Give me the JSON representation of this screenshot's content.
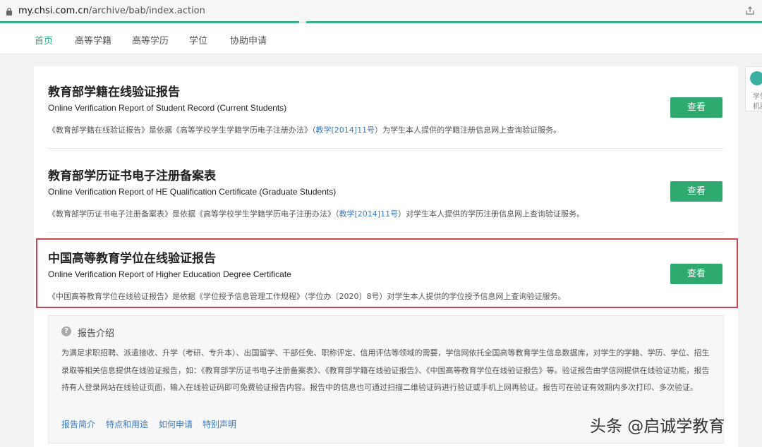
{
  "browser": {
    "url_host": "my.chsi.com.cn",
    "url_path": "/archive/bab/index.action"
  },
  "nav": {
    "items": [
      "首页",
      "高等学籍",
      "高等学历",
      "学位",
      "协助申请"
    ]
  },
  "float_widget": {
    "line1": "学信",
    "line2": "机器"
  },
  "reports": [
    {
      "title": "教育部学籍在线验证报告",
      "title_en": "Online Verification Report of Student Record (Current Students)",
      "desc_pre": "《教育部学籍在线验证报告》是依据《高等学校学生学籍学历电子注册办法》（",
      "desc_link": "教学[2014]11号",
      "desc_post": "）为学生本人提供的学籍注册信息网上查询验证服务。",
      "button": "查看"
    },
    {
      "title": "教育部学历证书电子注册备案表",
      "title_en": "Online Verification Report of HE Qualification Certificate (Graduate Students)",
      "desc_pre": "《教育部学历证书电子注册备案表》是依据《高等学校学生学籍学历电子注册办法》（",
      "desc_link": "教学[2014]11号",
      "desc_post": "）对学生本人提供的学历注册信息网上查询验证服务。",
      "button": "查看"
    },
    {
      "title": "中国高等教育学位在线验证报告",
      "title_en": "Online Verification Report of Higher Education Degree Certificate",
      "desc_pre": "《中国高等教育学位在线验证报告》是依据《学位授予信息管理工作规程》（学位办〔2020〕8号）对学生本人提供的学位授予信息网上查询验证服务。",
      "desc_link": "",
      "desc_post": "",
      "button": "查看"
    }
  ],
  "intro": {
    "title": "报告介绍",
    "body": "为满足求职招聘、派遣接收、升学（考研、专升本）、出国留学、干部任免、职称评定、信用评估等领域的需要，学信网依托全国高等教育学生信息数据库，对学生的学籍、学历、学位、招生录取等相关信息提供在线验证报告，如：《教育部学历证书电子注册备案表》、《教育部学籍在线验证报告》、《中国高等教育学位在线验证报告》等。验证报告由学信网提供在线验证功能，报告持有人登录网站在线验证页面，输入在线验证码即可免费验证报告内容。报告中的信息也可通过扫描二维验证码进行验证或手机上网再验证。报告可在验证有效期内多次打印、多次验证。",
    "links": [
      "报告简介",
      "特点和用途",
      "如何申请",
      "特别声明"
    ]
  },
  "watermark": "头条 @启诚学教育",
  "colors": {
    "accent": "#3bb08f",
    "button": "#2eaa6f",
    "link": "#3a7bbf",
    "highlight_border": "#c84a4f"
  }
}
